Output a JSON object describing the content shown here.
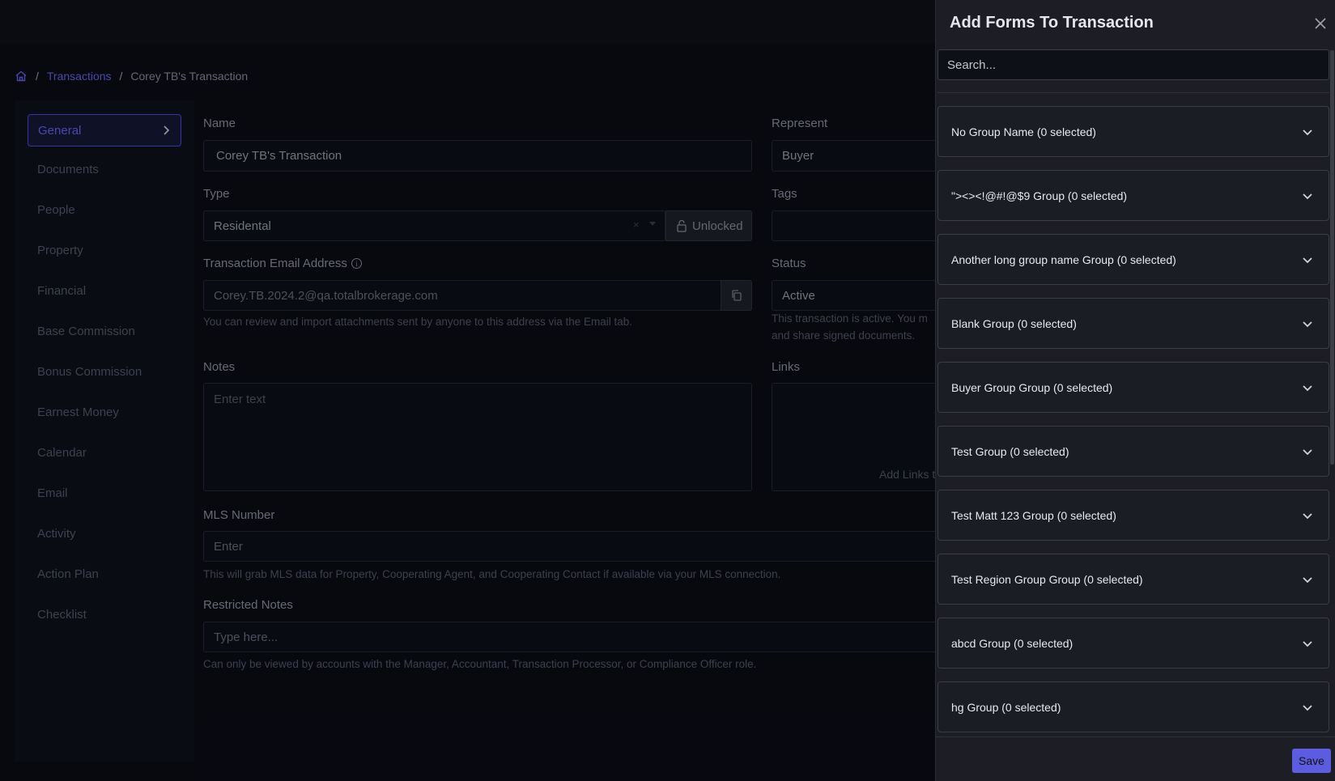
{
  "breadcrumb": {
    "link": "Transactions",
    "current": "Corey TB's Transaction"
  },
  "sidebar": {
    "items": [
      {
        "label": "General"
      },
      {
        "label": "Documents"
      },
      {
        "label": "People"
      },
      {
        "label": "Property"
      },
      {
        "label": "Financial"
      },
      {
        "label": "Base Commission"
      },
      {
        "label": "Bonus Commission"
      },
      {
        "label": "Earnest Money"
      },
      {
        "label": "Calendar"
      },
      {
        "label": "Email"
      },
      {
        "label": "Activity"
      },
      {
        "label": "Action Plan"
      },
      {
        "label": "Checklist"
      }
    ]
  },
  "form": {
    "name_label": "Name",
    "name_value": "Corey TB's Transaction",
    "represent_label": "Represent",
    "represent_value": "Buyer",
    "type_label": "Type",
    "type_value": "Residental",
    "lock_label": "Unlocked",
    "tags_label": "Tags",
    "email_label": "Transaction Email Address",
    "email_value": "Corey.TB.2024.2@qa.totalbrokerage.com",
    "email_hint": "You can review and import attachments sent by anyone to this address via the Email tab.",
    "status_label": "Status",
    "status_value": "Active",
    "status_hint_1": "This transaction is active. You m",
    "status_hint_2": "and share signed documents.",
    "notes_label": "Notes",
    "notes_placeholder": "Enter text",
    "links_label": "Links",
    "links_add": "Add Links t",
    "mls_label": "MLS Number",
    "mls_placeholder": "Enter",
    "mls_hint": "This will grab MLS data for Property, Cooperating Agent, and Cooperating Contact if available via your MLS connection.",
    "restricted_label": "Restricted Notes",
    "restricted_placeholder": "Type here...",
    "restricted_hint": "Can only be viewed by accounts with the Manager, Accountant, Transaction Processor, or Compliance Officer role."
  },
  "drawer": {
    "title": "Add Forms To Transaction",
    "search_placeholder": "Search...",
    "groups": [
      {
        "label": "No Group Name (0 selected)"
      },
      {
        "label": "\"><><!@#!@$9 Group (0 selected)"
      },
      {
        "label": "Another long group name Group (0 selected)"
      },
      {
        "label": "Blank Group (0 selected)"
      },
      {
        "label": "Buyer Group Group (0 selected)"
      },
      {
        "label": "Test Group (0 selected)"
      },
      {
        "label": "Test Matt 123 Group (0 selected)"
      },
      {
        "label": "Test Region Group Group (0 selected)"
      },
      {
        "label": "abcd Group (0 selected)"
      },
      {
        "label": "hg Group (0 selected)"
      }
    ],
    "save_label": "Save"
  }
}
